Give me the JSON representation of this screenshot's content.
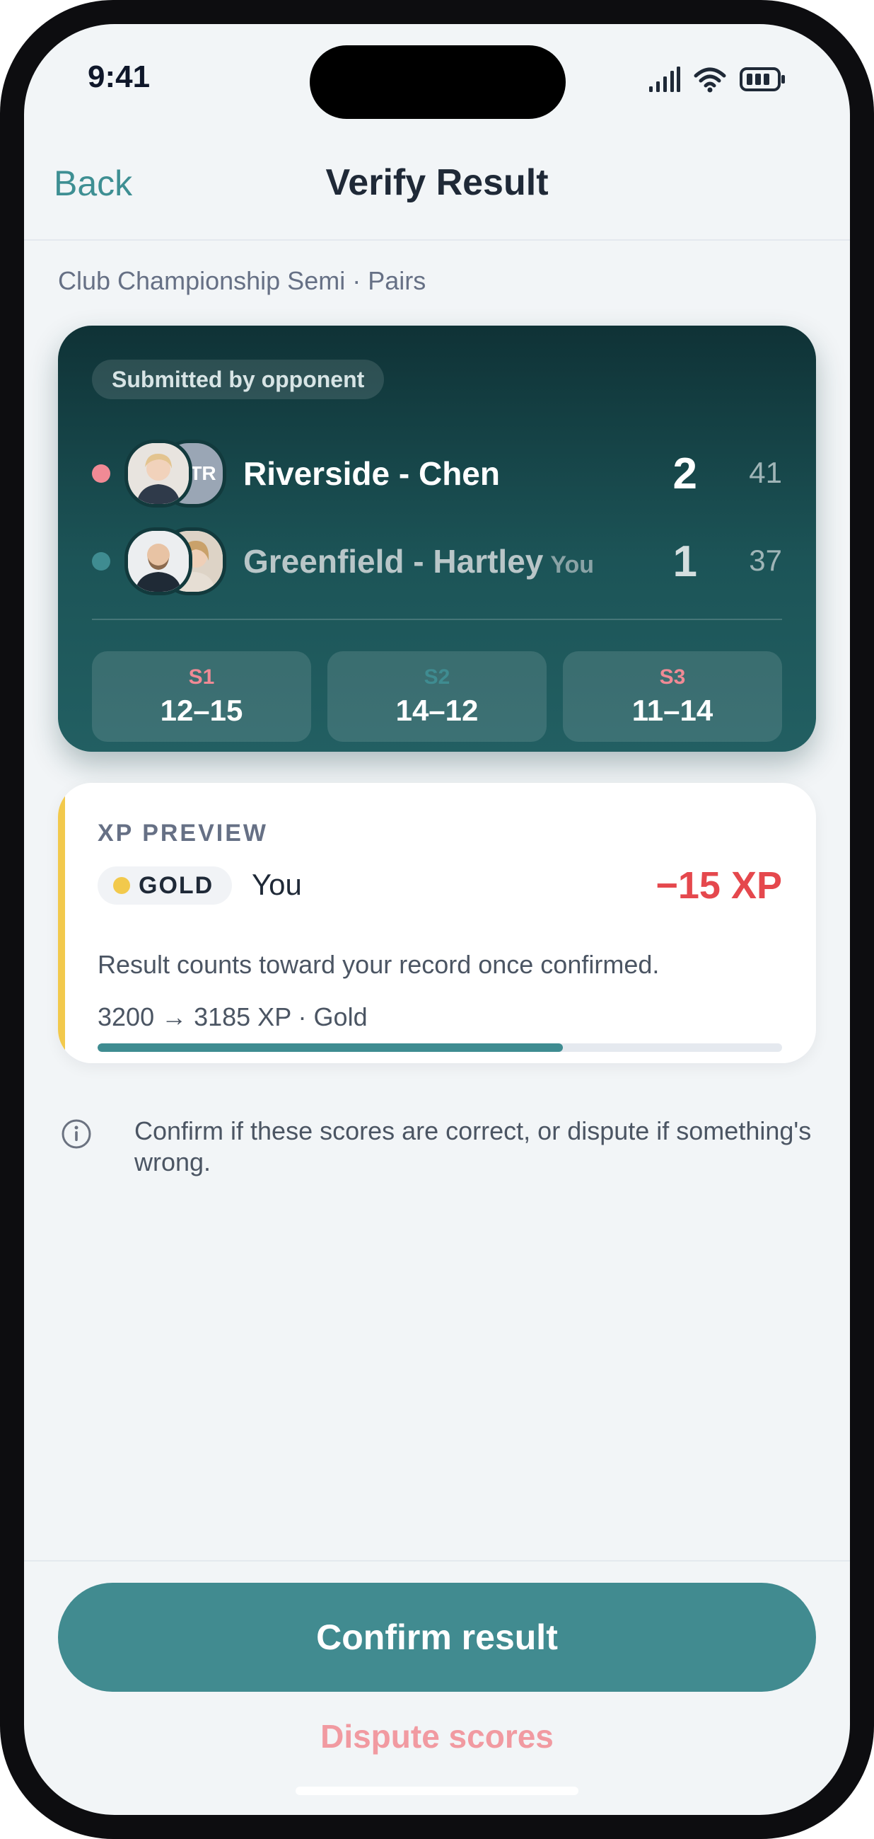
{
  "status_bar": {
    "time": "9:41"
  },
  "header": {
    "back_label": "Back",
    "title": "Verify Result"
  },
  "subtitle": "Club Championship Semi · Pairs",
  "match": {
    "submitted_label": "Submitted by opponent",
    "teams": [
      {
        "name": "Riverside - Chen",
        "you_label": "",
        "sets_won": "2",
        "points": "41",
        "dot_color": "#f08a95",
        "avatar_initials": "TR",
        "name_color": "#ffffff",
        "sets_color": "#ffffff"
      },
      {
        "name": "Greenfield - Hartley",
        "you_label": "You",
        "sets_won": "1",
        "points": "37",
        "dot_color": "#3f8c91",
        "avatar_initials": "",
        "name_color": "#b9c6c8",
        "sets_color": "#d4dedf"
      }
    ],
    "sets": [
      {
        "label": "S1",
        "score": "12–15",
        "label_color": "#f08a95"
      },
      {
        "label": "S2",
        "score": "14–12",
        "label_color": "#3f8c91"
      },
      {
        "label": "S3",
        "score": "11–14",
        "label_color": "#f08a95"
      }
    ]
  },
  "xp_preview": {
    "heading": "XP PREVIEW",
    "tier": "GOLD",
    "player": "You",
    "delta": "−15 XP",
    "note": "Result counts toward your record once confirmed.",
    "range": "3200 → 3185 XP · Gold",
    "progress_fraction": 0.68,
    "accent_color": "#f2c94c"
  },
  "info_text": "Confirm if these scores are correct, or dispute if something's wrong.",
  "actions": {
    "confirm_label": "Confirm result",
    "dispute_label": "Dispute scores"
  },
  "colors": {
    "brand_teal": "#418b90",
    "negative_red": "#e5484d",
    "dispute_pink": "#f19aa1"
  }
}
